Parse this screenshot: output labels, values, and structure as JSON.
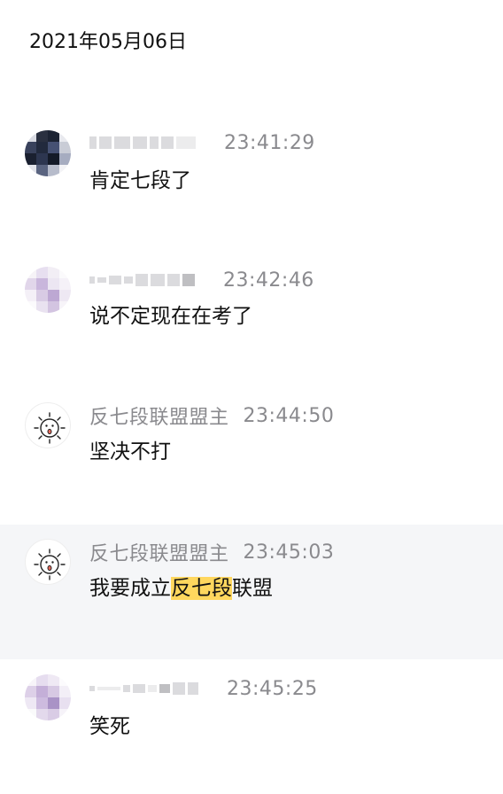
{
  "date_header": "2021年05月06日",
  "messages": [
    {
      "sender": "",
      "time": "23:41:29",
      "text": "肯定七段了"
    },
    {
      "sender": "",
      "time": "23:42:46",
      "text": "说不定现在在考了"
    },
    {
      "sender": "反七段联盟盟主",
      "time": "23:44:50",
      "text": "坚决不打"
    },
    {
      "sender": "反七段联盟盟主",
      "time": "23:45:03",
      "text_before": "我要成立",
      "text_highlight": "反七段",
      "text_after": "联盟"
    },
    {
      "sender": "",
      "time": "23:45:25",
      "text": "笑死"
    }
  ],
  "colors": {
    "highlight": "#ffd75e",
    "selected_row_bg": "#f5f6f8",
    "meta_text": "#8a8a8e"
  },
  "icons": {
    "avatar_1": "pixelated-avatar",
    "avatar_2": "pixelated-avatar",
    "avatar_3": "sun-face-avatar",
    "avatar_4": "sun-face-avatar",
    "avatar_5": "pixelated-avatar"
  }
}
